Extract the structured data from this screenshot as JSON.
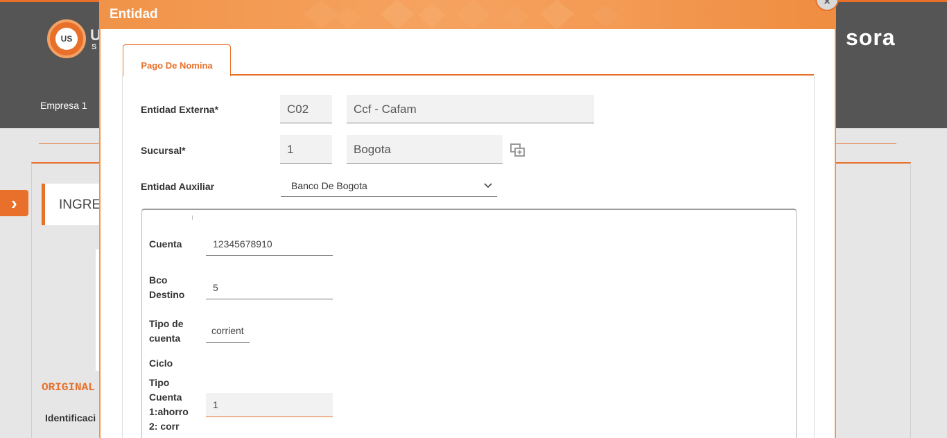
{
  "background": {
    "logo_text": "US",
    "brand": "U",
    "brand_sub": "S",
    "sora": "sora",
    "company": "Empresa 1",
    "card_title": "INGRE",
    "original_label": "ORIGINAL",
    "ident_label": "Identificaci"
  },
  "modal": {
    "title": "Entidad",
    "close_icon": "×",
    "tabs": [
      {
        "label": "Pago De Nomina"
      }
    ],
    "form": {
      "entidad_externa": {
        "label": "Entidad Externa*",
        "code": "C02",
        "name": "Ccf - Cafam"
      },
      "sucursal": {
        "label": "Sucursal*",
        "code": "1",
        "name": "Bogota"
      },
      "entidad_auxiliar": {
        "label": "Entidad Auxiliar",
        "selected": "Banco De Bogota"
      }
    },
    "subform": {
      "cuenta": {
        "label": "Cuenta",
        "value": "12345678910"
      },
      "bco_destino": {
        "label_line1": "Bco",
        "label_line2": "Destino",
        "value": "5"
      },
      "tipo_de_cuenta": {
        "label_line1": "Tipo de",
        "label_line2": "cuenta",
        "value": "corrient"
      },
      "ciclo": {
        "label": "Ciclo"
      },
      "tipo_cuenta": {
        "label_lines": [
          "Tipo",
          "Cuenta",
          "1:ahorro",
          "2: corr"
        ],
        "value": "1"
      }
    }
  }
}
